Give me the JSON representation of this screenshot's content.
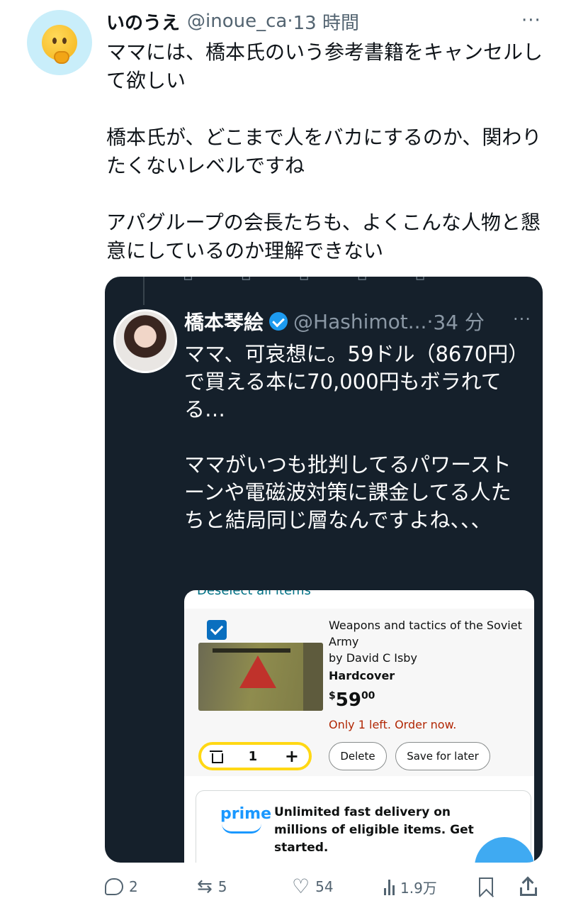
{
  "tweet": {
    "name": "いのうえ",
    "handle": "@inoue_ca",
    "separator": "·",
    "time": "13 時間",
    "text": "ママには、橋本氏のいう参考書籍をキャンセルして欲しい\n\n橋本氏が、どこまで人をバカにするのか、関わりたくないレベルですね\n\nアパグループの会長たちも、よくこんな人物と懇意にしているのか理解できない",
    "avatar_icon": "thinking-face-icon"
  },
  "quoted": {
    "name": "橋本琴絵",
    "handle": "@Hashimot...",
    "separator": "·",
    "time": "34 分",
    "text": "ママ、可哀想に。59ドル（8670円）で買える本に70,000円もボラれてる…\n\nママがいつも批判してるパワーストーンや電磁波対策に課金してる人たちと結局同じ層なんですよね、、、",
    "verified_color": "#1d9bf0"
  },
  "cart": {
    "deselect_label": "Deselect all items",
    "item": {
      "title": "Weapons and tactics of the Soviet Army",
      "author": "by David C Isby",
      "format": "Hardcover",
      "price_symbol": "$",
      "price_whole": "59",
      "price_fraction": "00",
      "stock": "Only 1 left. Order now.",
      "quantity": "1",
      "checked": true
    },
    "delete_label": "Delete",
    "save_label": "Save for later",
    "prime": {
      "logo": "prime",
      "text": "Unlimited fast delivery on millions of eligible items. Get started."
    }
  },
  "actions": {
    "replies": "2",
    "retweets": "5",
    "likes": "54",
    "views": "1.9万"
  },
  "colors": {
    "accent": "#1d9bf0",
    "quote_bg": "#15202b",
    "stock_red": "#b12704",
    "qty_border": "#ffd814"
  }
}
